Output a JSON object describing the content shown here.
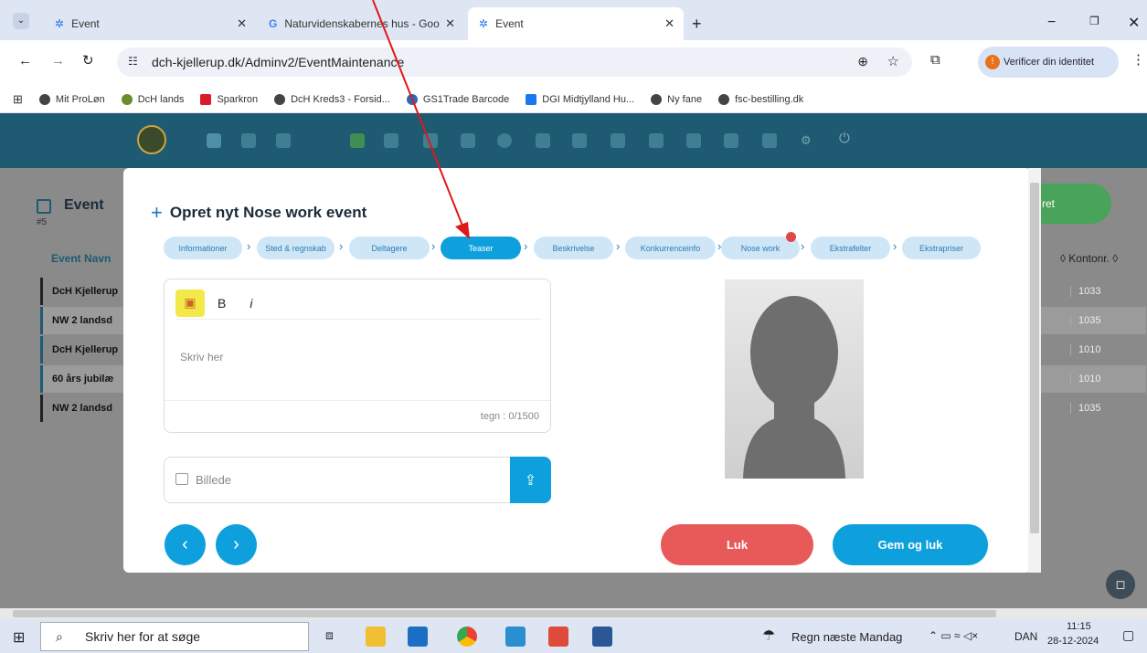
{
  "browser": {
    "tabs": [
      {
        "title": "Event"
      },
      {
        "title": "Naturvidenskabernes hus - Goo"
      },
      {
        "title": "Event"
      }
    ],
    "url": "dch-kjellerup.dk/Adminv2/EventMaintenance",
    "verify_label": "Verificer din identitet",
    "bookmarks": [
      "Mit ProLøn",
      "DcH lands",
      "Sparkron",
      "DcH Kreds3 - Forsid...",
      "GS1Trade Barcode",
      "DGI Midtjylland Hu...",
      "Ny fane",
      "fsc-bestilling.dk"
    ]
  },
  "page": {
    "title": "Event",
    "subtitle": "#5",
    "column_event": "Event Navn",
    "column_konto": "Kontonr.",
    "create_btn": "ret",
    "rows": [
      {
        "name": "DcH Kjellerup",
        "konto": "1033"
      },
      {
        "name": "NW 2 landsd",
        "konto": "1035"
      },
      {
        "name": "DcH Kjellerup",
        "konto": "1010"
      },
      {
        "name": "60 års jubilæ",
        "konto": "1010"
      },
      {
        "name": "NW 2 landsd",
        "konto": "1035"
      }
    ]
  },
  "modal": {
    "title": "Opret nyt Nose work event",
    "steps": [
      "Informationer",
      "Sted & regnskab",
      "Deltagere",
      "Teaser",
      "Beskrivelse",
      "Konkurrenceinfo",
      "Nose work",
      "Ekstrafelter",
      "Ekstrapriser"
    ],
    "active_step": "Teaser",
    "editor": {
      "bold": "B",
      "italic": "i",
      "placeholder": "Skriv her",
      "counter": "tegn : 0/1500"
    },
    "image_placeholder": "Billede",
    "close_btn": "Luk",
    "save_btn": "Gem og luk"
  },
  "taskbar": {
    "search": "Skriv her for at søge",
    "weather": "Regn næste Mandag",
    "lang": "DAN",
    "time": "11:15",
    "date": "28-12-2024"
  },
  "colors": {
    "accent": "#0ea0dd",
    "danger": "#e85a5a",
    "header": "#1e5a72",
    "annotation": "#e01818"
  }
}
